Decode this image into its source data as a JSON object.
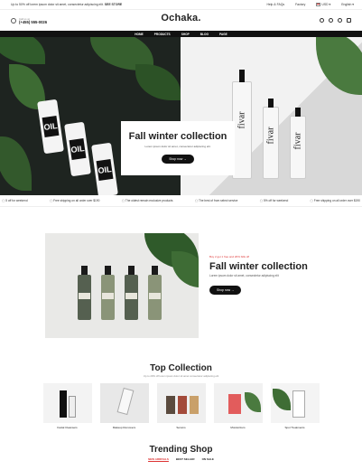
{
  "topbar": {
    "promo": "Up to 50% off lorem ipsum dolor sit amet, consectetur adipiscing elit.",
    "link1": "SEE",
    "link2": "STORE",
    "help": "Help & FAQs",
    "faq": "Factory",
    "currency": "USD",
    "language": "English"
  },
  "header": {
    "call_label": "Call us at",
    "phone": "(+455) 555-0026",
    "logo": "Ochaka."
  },
  "nav": [
    "HOME",
    "PRODUCTS",
    "SHOP",
    "BLOG",
    "PAGE"
  ],
  "hero": {
    "can_text": "OIL",
    "bottle_text": "fivar",
    "title": "Fall winter collection",
    "subtitle": "Lorem ipsum dolor sit amet, consectetur adipiscing elit.",
    "button": "Shop now"
  },
  "ticker": [
    "5 off for weekend",
    "Free shipping on all order over $190",
    "The oldest remain exclusive products",
    "The best of from select service",
    "5% off for weekend",
    "Free shipping on all order over $190"
  ],
  "feature": {
    "tag": "Buy 2 get 1 free and 20% bills off",
    "title": "Fall winter collection",
    "subtitle": "Lorem ipsum dolor sit amet, consectetur adipiscing elit",
    "button": "Shop now"
  },
  "collection": {
    "title": "Top Collection",
    "subtitle": "Up to 20% off lorem ipsum dolor sit amet consectetur adipiscing elit",
    "items": [
      "Facial Cleansers",
      "Makeup Removers",
      "Serums",
      "Moisturizers",
      "Spot Treatments"
    ]
  },
  "trending": {
    "title": "Trending Shop",
    "tabs": [
      "NEW ARRIVALS",
      "BEST SELLER",
      "ON SALE"
    ]
  }
}
